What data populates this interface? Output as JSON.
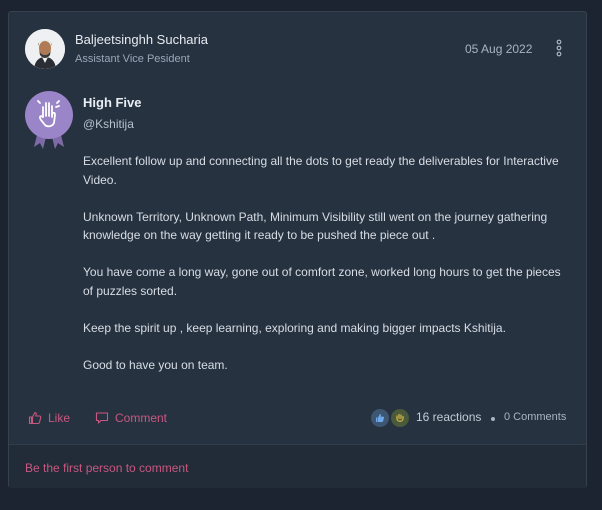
{
  "post": {
    "author": {
      "name": "Baljeetsinghh Sucharia",
      "title": "Assistant Vice Pesident"
    },
    "date": "05 Aug 2022",
    "badge": {
      "title": "High Five",
      "icon": "hand-icon",
      "color": "#9b85c9"
    },
    "mention": "@Kshitija",
    "message": [
      "Excellent follow up and connecting all the dots to get ready the deliverables for Interactive Video.",
      "Unknown Territory, Unknown Path, Minimum Visibility still went on the journey gathering knowledge on the way getting it ready to be pushed the piece out .",
      "You have come a long way, gone out of comfort zone, worked long hours to get the pieces of puzzles sorted.",
      "Keep the spirit up , keep learning, exploring and making bigger impacts Kshitija.",
      "Good to have you on team."
    ]
  },
  "actions": {
    "like_label": "Like",
    "comment_label": "Comment",
    "reactions_label": "16 reactions",
    "comments_label": "0 Comments"
  },
  "footer": {
    "first_comment_label": "Be the first person to comment"
  },
  "colors": {
    "accent": "#c9577f",
    "card": "#273241",
    "background": "#1b2430"
  }
}
